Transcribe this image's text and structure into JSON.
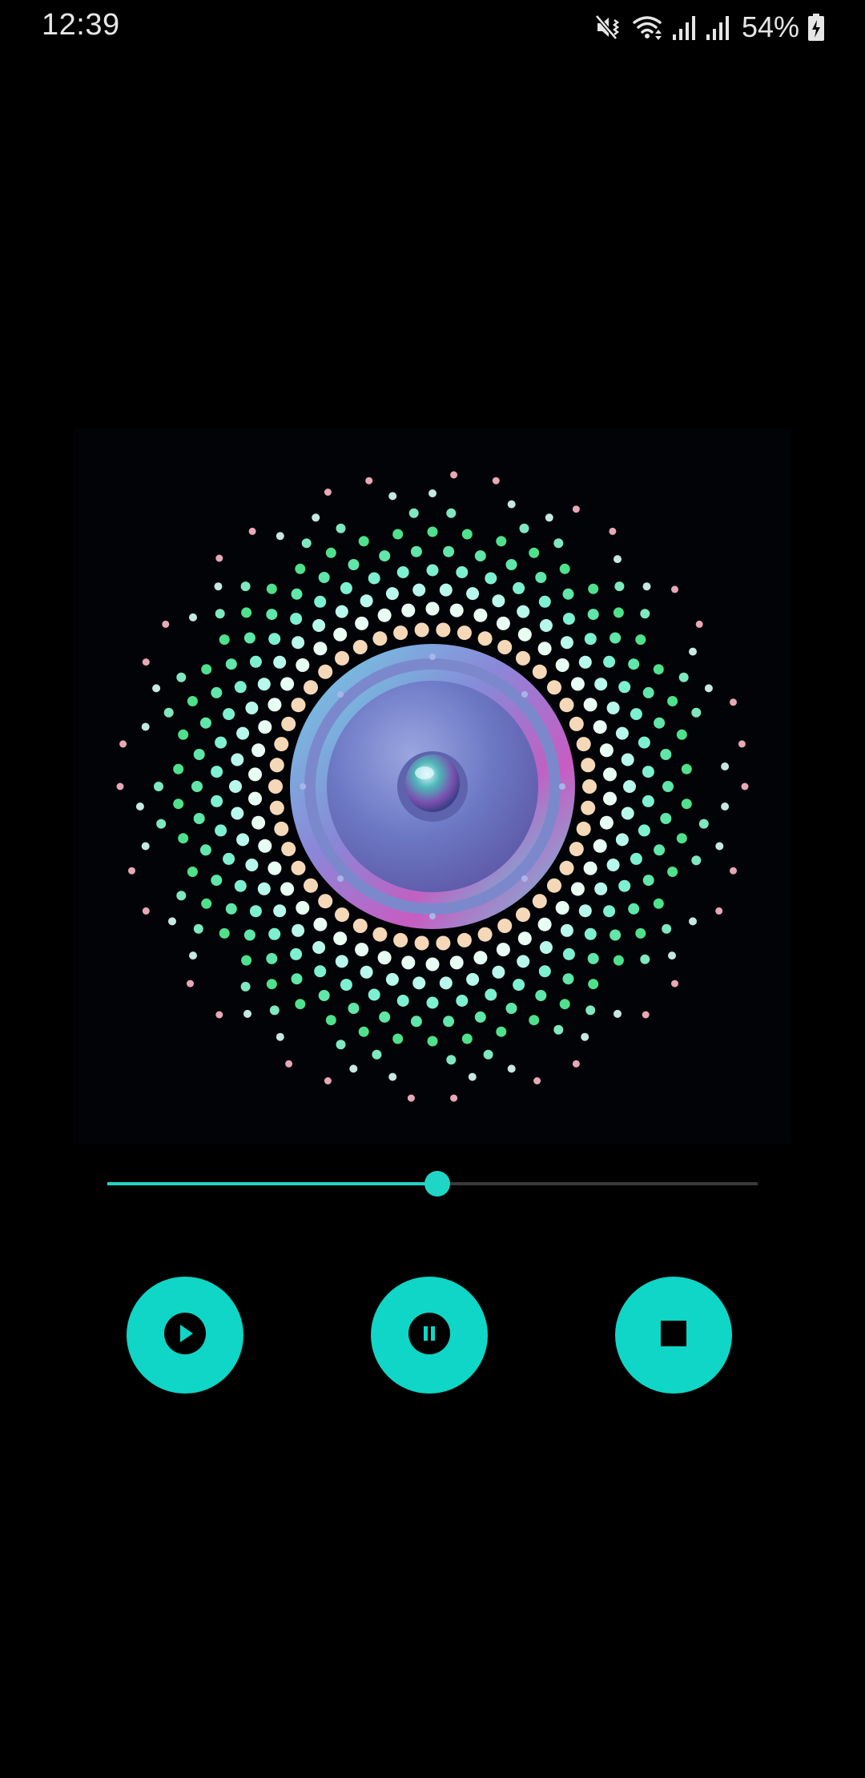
{
  "status_bar": {
    "time": "12:39",
    "battery_percent": "54%",
    "icons": [
      "mute-vibrate-icon",
      "wifi-icon",
      "signal-icon",
      "signal-icon",
      "battery-charging-icon"
    ]
  },
  "player": {
    "artwork": "speaker-visualizer-image",
    "progress": 0.507,
    "buttons": {
      "play": "play-icon",
      "pause": "pause-icon",
      "stop": "stop-icon"
    }
  },
  "colors": {
    "accent": "#0fd6c6",
    "background": "#000000"
  }
}
